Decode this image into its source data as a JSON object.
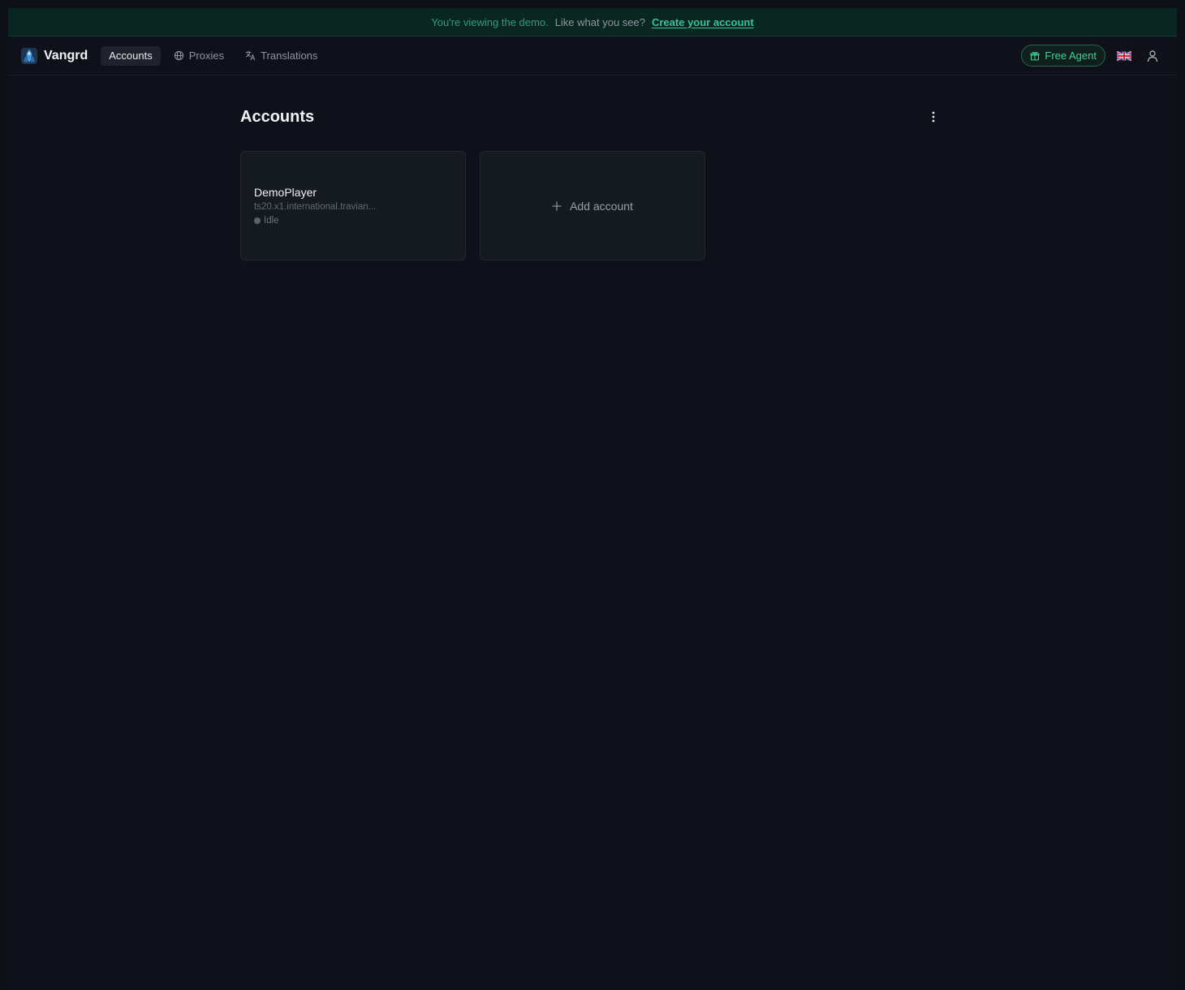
{
  "banner": {
    "message": "You're viewing the demo.",
    "question": "Like what you see?",
    "cta": "Create your account"
  },
  "brand": {
    "name": "Vangrd",
    "logo_icon": "vangrd-logo-icon"
  },
  "nav": {
    "items": [
      {
        "label": "Accounts",
        "icon": null,
        "active": true
      },
      {
        "label": "Proxies",
        "icon": "globe-icon",
        "active": false
      },
      {
        "label": "Translations",
        "icon": "translate-icon",
        "active": false
      }
    ],
    "free_agent_label": "Free Agent",
    "language_icon": "uk-flag-icon",
    "user_icon": "user-icon"
  },
  "page": {
    "title": "Accounts",
    "more_icon": "more-vertical-icon"
  },
  "accounts": [
    {
      "name": "DemoPlayer",
      "server": "ts20.x1.international.travian...",
      "status": "Idle"
    }
  ],
  "add_account_label": "Add account",
  "colors": {
    "accent": "#34c596",
    "background": "#0f111a",
    "card": "#151920",
    "banner": "#0a2620"
  }
}
